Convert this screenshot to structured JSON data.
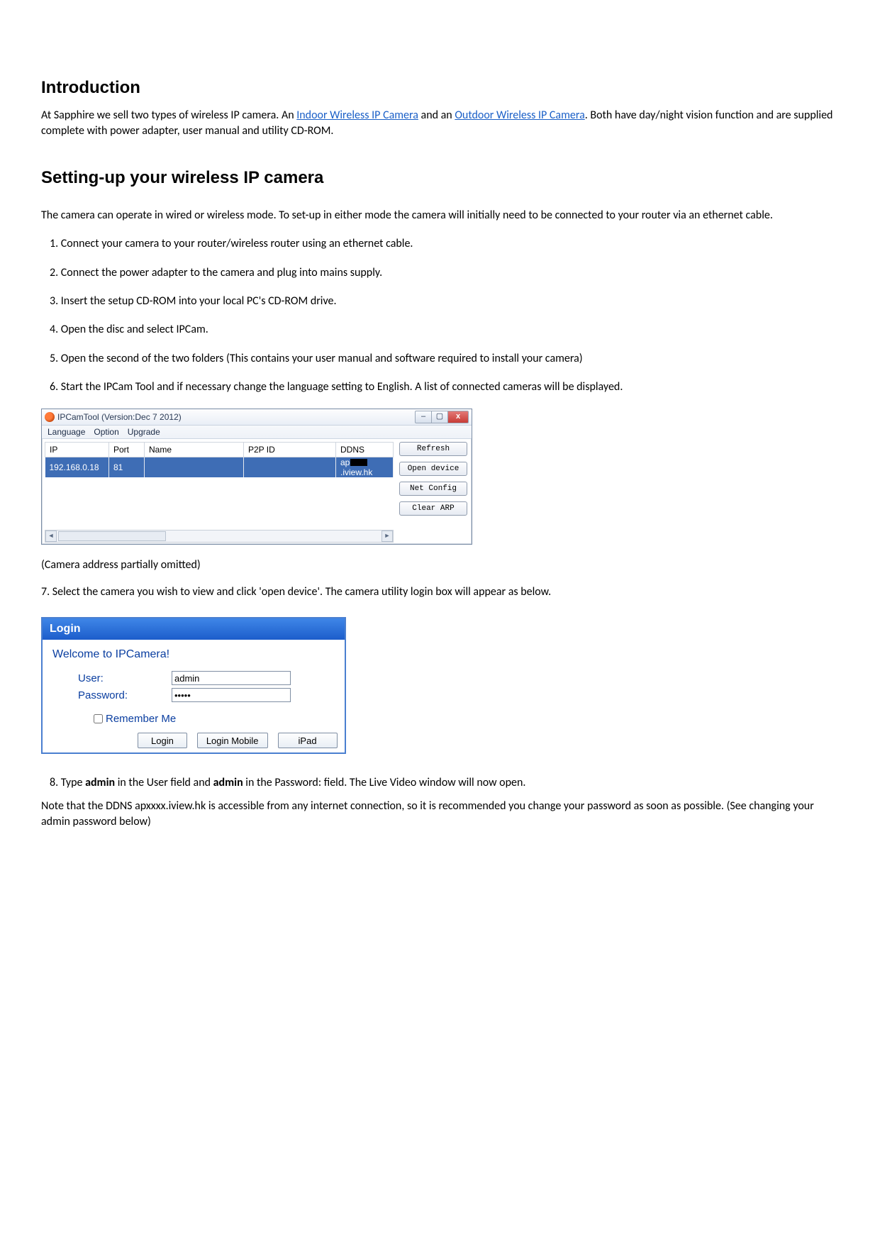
{
  "headings": {
    "intro": "Introduction",
    "setup": "Setting-up your wireless IP camera"
  },
  "intro": {
    "pre": "At Sapphire we sell two types of wireless IP camera. An ",
    "link1": "Indoor Wireless IP Camera",
    "mid": " and an ",
    "link2": "Outdoor Wireless IP Camera",
    "post": ". Both have day/night vision function and are supplied complete with power adapter, user manual and utility CD-ROM."
  },
  "setup_lead": "The camera can operate in wired or wireless mode. To set-up in either mode the camera will initially need to be connected to your router via an ethernet cable.",
  "steps": {
    "s1": "1. Connect your camera to your router/wireless router using an ethernet cable.",
    "s2": "2. Connect the power adapter to the camera and plug into mains supply.",
    "s3": "3. Insert the setup CD-ROM into your local PC's CD-ROM drive.",
    "s4": "4. Open the disc and select IPCam.",
    "s5": "5. Open the second of the two folders (This contains your user manual and software required to install your camera)",
    "s6": "6. Start the IPCam Tool and if necessary change the language setting to English. A list of connected cameras will be displayed."
  },
  "camtool": {
    "title": "IPCamTool (Version:Dec  7 2012)",
    "menu": {
      "m1": "Language",
      "m2": "Option",
      "m3": "Upgrade"
    },
    "cols": {
      "ip": "IP",
      "port": "Port",
      "name": "Name",
      "p2pid": "P2P ID",
      "ddns": "DDNS"
    },
    "row": {
      "ip": "192.168.0.18",
      "port": "81",
      "name": "",
      "p2pid": "",
      "ddns_pre": "ap",
      "ddns_post": ".iview.hk"
    },
    "buttons": {
      "refresh": "Refresh",
      "open": "Open device",
      "net": "Net Config",
      "clear": "Clear ARP"
    },
    "winctrl": {
      "min": "–",
      "max": "▢",
      "close": "x"
    }
  },
  "caption_omitted": "(Camera address partially omitted)",
  "step7": "7. Select the camera you wish to view and click 'open device'.    The camera utility login box will appear as below.",
  "login": {
    "title": "Login",
    "welcome": "Welcome to IPCamera!",
    "user_label": "User:",
    "pass_label": "Password:",
    "user_value": "admin",
    "pass_value": "•••••",
    "remember": "Remember Me",
    "btn_login": "Login",
    "btn_mobile": "Login Mobile",
    "btn_ipad": "iPad"
  },
  "step8": {
    "pre": "8. Type ",
    "b1": "admin",
    "mid1": " in the User field and ",
    "b2": "admin",
    "mid2": " in the Password: field.    The Live Video window will now open."
  },
  "note": "Note that the DDNS apxxxx.iview.hk is accessible from any internet connection, so it is recommended you change your password as soon as possible. (See changing your admin password below)"
}
